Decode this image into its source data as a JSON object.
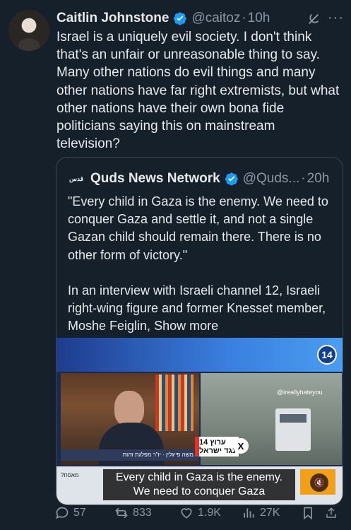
{
  "tweet": {
    "author_name": "Caitlin Johnstone",
    "handle": "@caitoz",
    "separator": "·",
    "time": "10h",
    "more": "···",
    "text": "Israel is a uniquely evil society. I don't think that's an unfair or unreasonable thing to say. Many other nations do evil things and many other nations have far right extremists, but what other nations have their own bona fide politicians saying this on mainstream television?"
  },
  "quoted": {
    "logo_text": "قدس",
    "author_name": "Quds News Network",
    "handle": "@Quds...",
    "separator": "·",
    "time": "20h",
    "paragraph1": "\"Every child in Gaza is the enemy. We need to conquer Gaza and settle it, and not a single Gazan child should remain there. There is no other form of victory.\"",
    "paragraph2": "In an interview with Israeli channel 12, Israeli right-wing figure and former Knesset member, Moshe Feiglin, ",
    "show_more": "Show more",
    "video": {
      "channel_badge": "14",
      "watermark": "@ireallyhateyou",
      "name_strip": "משה פייגלין · יו\"ר מפלגת זהות",
      "logo_text": "14 ערוץ נגד ישראל",
      "x_logo": "X",
      "caption_line1": "Every child in Gaza is the enemy.",
      "caption_line2": "We need to conquer Gaza",
      "bottom_left": "?מאסח",
      "mute_icon": "🔇"
    }
  },
  "actions": {
    "replies": "57",
    "retweets": "833",
    "likes": "1.9K",
    "views": "27K"
  },
  "colors": {
    "background": "#15202b",
    "text": "#e7e9ea",
    "muted": "#8b98a5",
    "verified": "#1d9bf0",
    "border": "#38444d"
  }
}
